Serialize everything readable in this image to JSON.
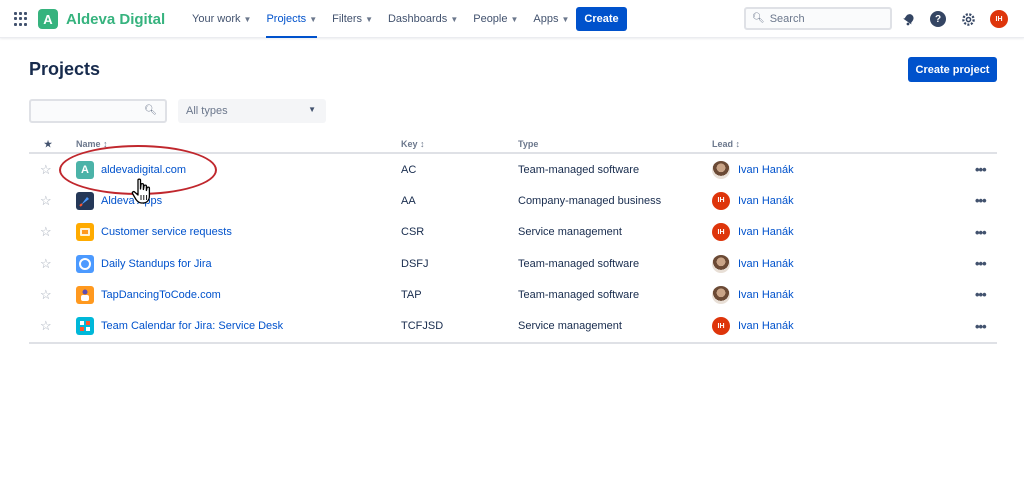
{
  "header": {
    "brand": "Aldeva Digital",
    "brand_letter": "A",
    "nav": [
      {
        "label": "Your work",
        "active": false
      },
      {
        "label": "Projects",
        "active": true
      },
      {
        "label": "Filters",
        "active": false
      },
      {
        "label": "Dashboards",
        "active": false
      },
      {
        "label": "People",
        "active": false
      },
      {
        "label": "Apps",
        "active": false
      }
    ],
    "create_label": "Create",
    "search_placeholder": "Search",
    "avatar_initials": "IH"
  },
  "page": {
    "title": "Projects",
    "create_project_label": "Create project",
    "filter_search_value": "",
    "type_filter": "All types"
  },
  "table": {
    "columns": {
      "name": "Name",
      "key": "Key",
      "type": "Type",
      "lead": "Lead"
    },
    "rows": [
      {
        "name": "aldevadigital.com",
        "key": "AC",
        "type": "Team-managed software",
        "lead": "Ivan Hanák",
        "icon": "letter-a-icon",
        "icon_letter": "A",
        "icon_color": "#4bb3a8",
        "lead_avatar": "photo",
        "lead_initials": ""
      },
      {
        "name": "Aldeva Apps",
        "key": "AA",
        "type": "Company-managed business",
        "lead": "Ivan Hanák",
        "icon": "rocket-icon",
        "icon_color": "#253858",
        "lead_avatar": "initials",
        "lead_initials": "IH"
      },
      {
        "name": "Customer service requests",
        "key": "CSR",
        "type": "Service management",
        "lead": "Ivan Hanák",
        "icon": "folder-icon",
        "icon_color": "#ffab00",
        "lead_avatar": "initials",
        "lead_initials": "IH"
      },
      {
        "name": "Daily Standups for Jira",
        "key": "DSFJ",
        "type": "Team-managed software",
        "lead": "Ivan Hanák",
        "icon": "chat-icon",
        "icon_color": "#4c9aff",
        "lead_avatar": "photo",
        "lead_initials": ""
      },
      {
        "name": "TapDancingToCode.com",
        "key": "TAP",
        "type": "Team-managed software",
        "lead": "Ivan Hanák",
        "icon": "person-icon",
        "icon_color": "#ff991f",
        "lead_avatar": "photo",
        "lead_initials": ""
      },
      {
        "name": "Team Calendar for Jira: Service Desk",
        "key": "TCFJSD",
        "type": "Service management",
        "lead": "Ivan Hanák",
        "icon": "calendar-icon",
        "icon_color": "#00b8d9",
        "lead_avatar": "initials",
        "lead_initials": "IH"
      }
    ]
  },
  "colors": {
    "primary": "#0052cc",
    "brand": "#36b37e",
    "highlight_ring": "#c0272d",
    "lead_initials_bg": "#de350b"
  }
}
